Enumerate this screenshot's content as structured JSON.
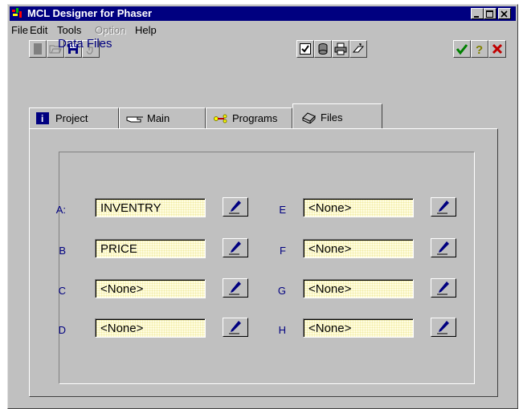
{
  "window": {
    "title": "MCL Designer for Phaser",
    "buttons": [
      "minimize",
      "maximize",
      "close"
    ]
  },
  "menu": {
    "file": "File",
    "edit": "Edit",
    "tools": "Tools",
    "option": "Option",
    "help": "Help"
  },
  "toolbar": {
    "left": [
      "new-icon",
      "open-icon",
      "save-icon",
      "pointer-icon"
    ],
    "right_group": [
      "checkbox-icon",
      "database-icon",
      "print-icon",
      "erase-icon"
    ],
    "final_group": [
      "ok-check-icon",
      "help-question-icon",
      "cancel-x-icon"
    ],
    "colors": {
      "check": "#008000",
      "question": "#808000",
      "cancel": "#c00000"
    }
  },
  "tabs": [
    {
      "label": "Project",
      "icon": "info-icon"
    },
    {
      "label": "Main",
      "icon": "hand-icon"
    },
    {
      "label": "Programs",
      "icon": "programs-icon"
    },
    {
      "label": "Files",
      "icon": "files-icon",
      "active": true
    }
  ],
  "panel": {
    "group_title": "Data Files",
    "left": [
      {
        "label": "A:",
        "value": "INVENTRY"
      },
      {
        "label": "B",
        "value": "PRICE"
      },
      {
        "label": "C",
        "value": "<None>"
      },
      {
        "label": "D",
        "value": "<None>"
      }
    ],
    "right": [
      {
        "label": "E",
        "value": "<None>"
      },
      {
        "label": "F",
        "value": "<None>"
      },
      {
        "label": "G",
        "value": "<None>"
      },
      {
        "label": "H",
        "value": "<None>"
      }
    ]
  }
}
